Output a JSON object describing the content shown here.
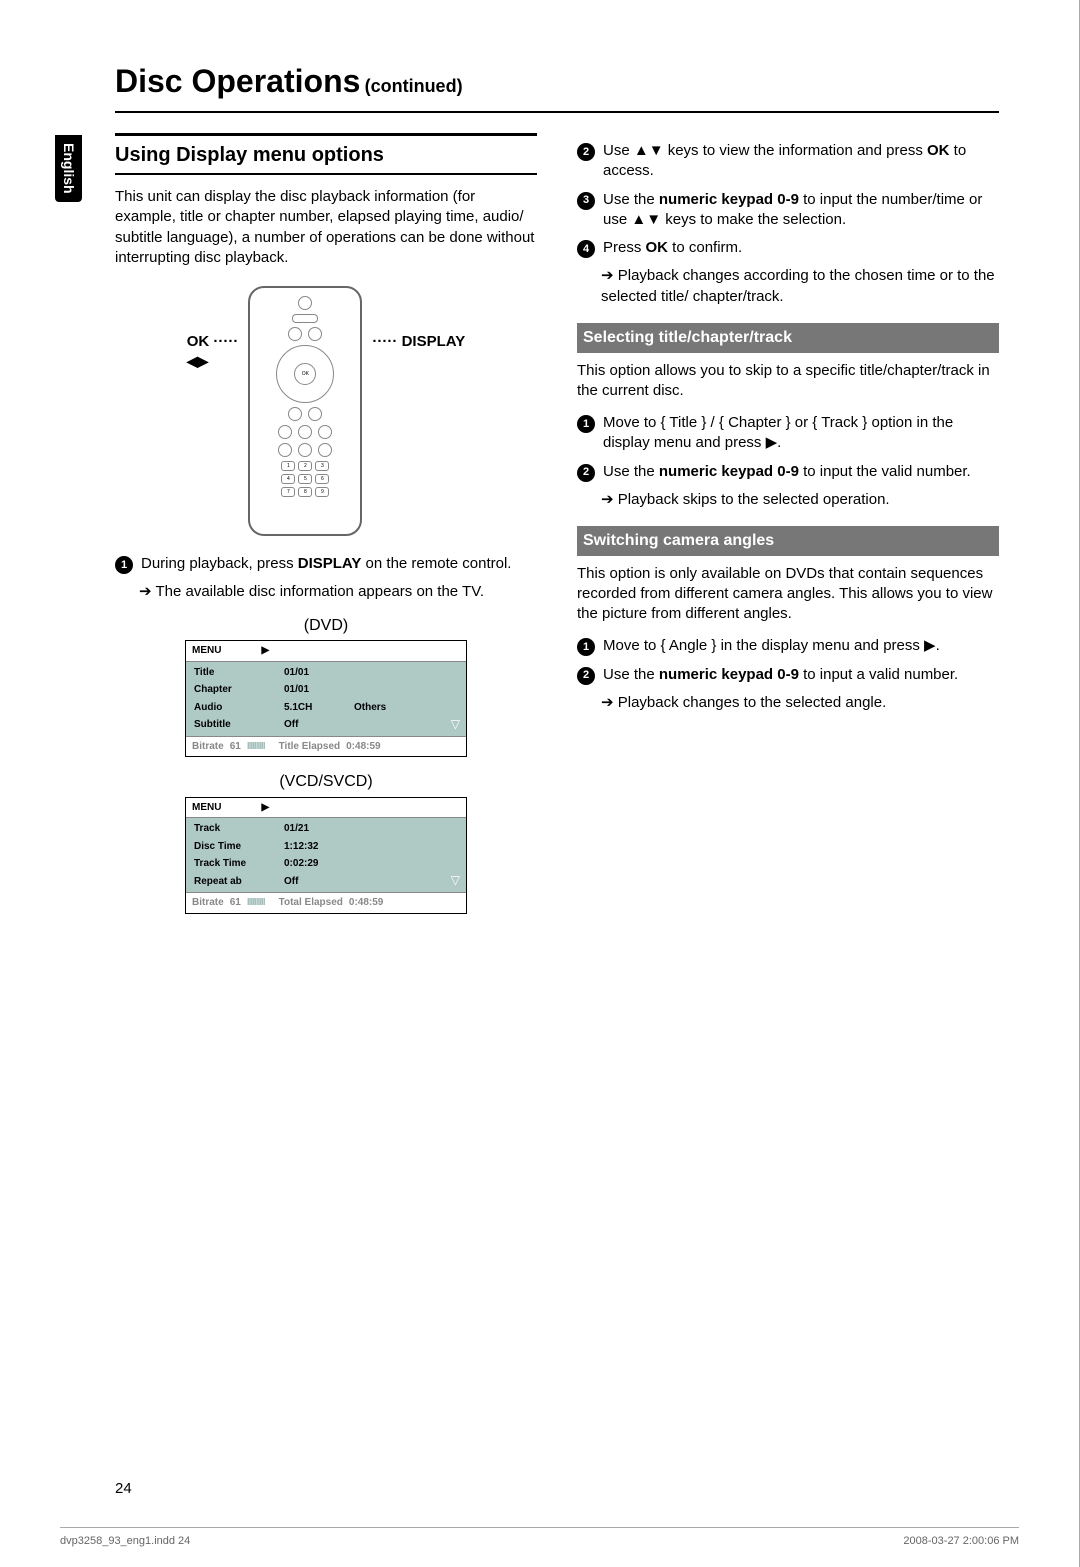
{
  "tab": "English",
  "title_main": "Disc Operations",
  "title_sub": "(continued)",
  "section": "Using Display menu options",
  "intro": "This unit can display the disc playback information (for example, title or chapter number, elapsed playing time, audio/ subtitle language), a number of operations can be done without interrupting disc playback.",
  "remote": {
    "left_label": "OK",
    "left_arrows": "◀▶",
    "right_label": "DISPLAY"
  },
  "left_steps": {
    "s1": "During playback, press DISPLAY on the remote control.",
    "s1_sub": "The available disc information appears on the TV."
  },
  "osd_dvd": {
    "caption": "(DVD)",
    "header": "MENU",
    "header_arrow": "▶",
    "rows": [
      {
        "k": "Title",
        "v": "01/01",
        "v2": ""
      },
      {
        "k": "Chapter",
        "v": "01/01",
        "v2": ""
      },
      {
        "k": "Audio",
        "v": "5.1CH",
        "v2": "Others"
      },
      {
        "k": "Subtitle",
        "v": "Off",
        "v2": ""
      }
    ],
    "footer_left": "Bitrate",
    "footer_num": "61",
    "footer_bars": "IIIIIIIIII",
    "footer_label": "Title Elapsed",
    "footer_time": "0:48:59"
  },
  "osd_vcd": {
    "caption": "(VCD/SVCD)",
    "header": "MENU",
    "header_arrow": "▶",
    "rows": [
      {
        "k": "Track",
        "v": "01/21",
        "v2": ""
      },
      {
        "k": "Disc  Time",
        "v": "1:12:32",
        "v2": ""
      },
      {
        "k": "Track  Time",
        "v": "0:02:29",
        "v2": ""
      },
      {
        "k": "Repeat  ab",
        "v": "Off",
        "v2": ""
      }
    ],
    "footer_left": "Bitrate",
    "footer_num": "61",
    "footer_bars": "IIIIIIIIII",
    "footer_label": "Total Elapsed",
    "footer_time": "0:48:59"
  },
  "right_top": {
    "s2": "Use ▲▼ keys to view the information and press OK to access.",
    "s3": "Use the numeric keypad 0-9 to input the number/time or use ▲▼ keys to make the selection.",
    "s4": "Press OK to confirm.",
    "s4_sub": "Playback changes according to the chosen time or to the selected title/ chapter/track."
  },
  "sel_head": "Selecting title/chapter/track",
  "sel_intro": "This option allows you to skip to a specific title/chapter/track in the current disc.",
  "sel_steps": {
    "s1": "Move to { Title } / { Chapter } or { Track } option in the display menu and press ▶.",
    "s2": "Use the numeric keypad 0-9 to input the valid number.",
    "s2_sub": "Playback skips to the selected operation."
  },
  "ang_head": "Switching camera angles",
  "ang_intro": "This option is only available on DVDs that contain sequences recorded from different camera angles. This allows you to view the picture from different angles.",
  "ang_steps": {
    "s1": "Move to { Angle } in the display menu and press ▶.",
    "s2": "Use the numeric keypad 0-9 to input a valid number.",
    "s2_sub": "Playback changes to the selected angle."
  },
  "page_number": "24",
  "footer_left": "dvp3258_93_eng1.indd   24",
  "footer_right": "2008-03-27   2:00:06 PM"
}
